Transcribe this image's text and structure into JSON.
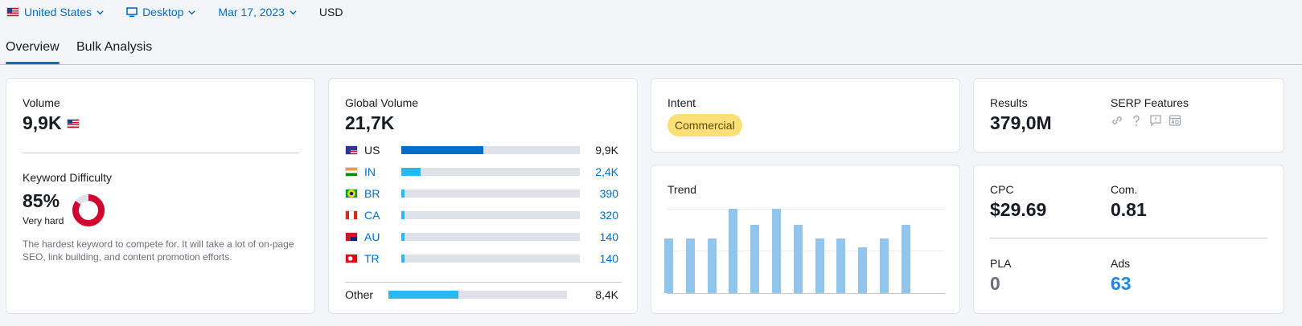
{
  "topbar": {
    "country": "United States",
    "device": "Desktop",
    "date": "Mar 17, 2023",
    "currency": "USD"
  },
  "tabs": [
    {
      "label": "Overview",
      "active": true
    },
    {
      "label": "Bulk Analysis",
      "active": false
    }
  ],
  "volume": {
    "label": "Volume",
    "value": "9,9K",
    "kd_label": "Keyword Difficulty",
    "kd_value": "85%",
    "kd_percent": 85,
    "kd_level": "Very hard",
    "kd_description": "The hardest keyword to compete for. It will take a lot of on-page SEO, link building, and content promotion efforts."
  },
  "global_volume": {
    "label": "Global Volume",
    "value": "21,7K",
    "rows": [
      {
        "code": "US",
        "value": "9,9K",
        "fraction": 0.46,
        "color": "#006dca",
        "link": false
      },
      {
        "code": "IN",
        "value": "2,4K",
        "fraction": 0.11,
        "color": "#2bb7f0",
        "link": true
      },
      {
        "code": "BR",
        "value": "390",
        "fraction": 0.02,
        "color": "#2bb7f0",
        "link": true
      },
      {
        "code": "CA",
        "value": "320",
        "fraction": 0.02,
        "color": "#2bb7f0",
        "link": true
      },
      {
        "code": "AU",
        "value": "140",
        "fraction": 0.02,
        "color": "#2bb7f0",
        "link": true
      },
      {
        "code": "TR",
        "value": "140",
        "fraction": 0.02,
        "color": "#2bb7f0",
        "link": true
      }
    ],
    "other": {
      "code": "Other",
      "value": "8,4K",
      "fraction": 0.39,
      "color": "#2bb7f0"
    }
  },
  "intent": {
    "label": "Intent",
    "badge": "Commercial"
  },
  "trend": {
    "label": "Trend",
    "values": [
      0.65,
      0.65,
      0.65,
      1.0,
      0.81,
      1.0,
      0.81,
      0.65,
      0.65,
      0.54,
      0.65,
      0.81
    ]
  },
  "results": {
    "label": "Results",
    "value": "379,0M",
    "serp_label": "SERP Features",
    "serp_icons": [
      "link-icon",
      "question-icon",
      "review-icon",
      "ads-icon"
    ]
  },
  "metrics": {
    "cpc_label": "CPC",
    "cpc_value": "$29.69",
    "com_label": "Com.",
    "com_value": "0.81",
    "pla_label": "PLA",
    "pla_value": "0",
    "ads_label": "Ads",
    "ads_value": "63"
  },
  "colors": {
    "accent": "#006dca",
    "kd_red": "#d1002f",
    "trend_bar": "#92c5ec",
    "intent_badge": "#fcdf77",
    "ads_blue": "#1e88e5"
  }
}
